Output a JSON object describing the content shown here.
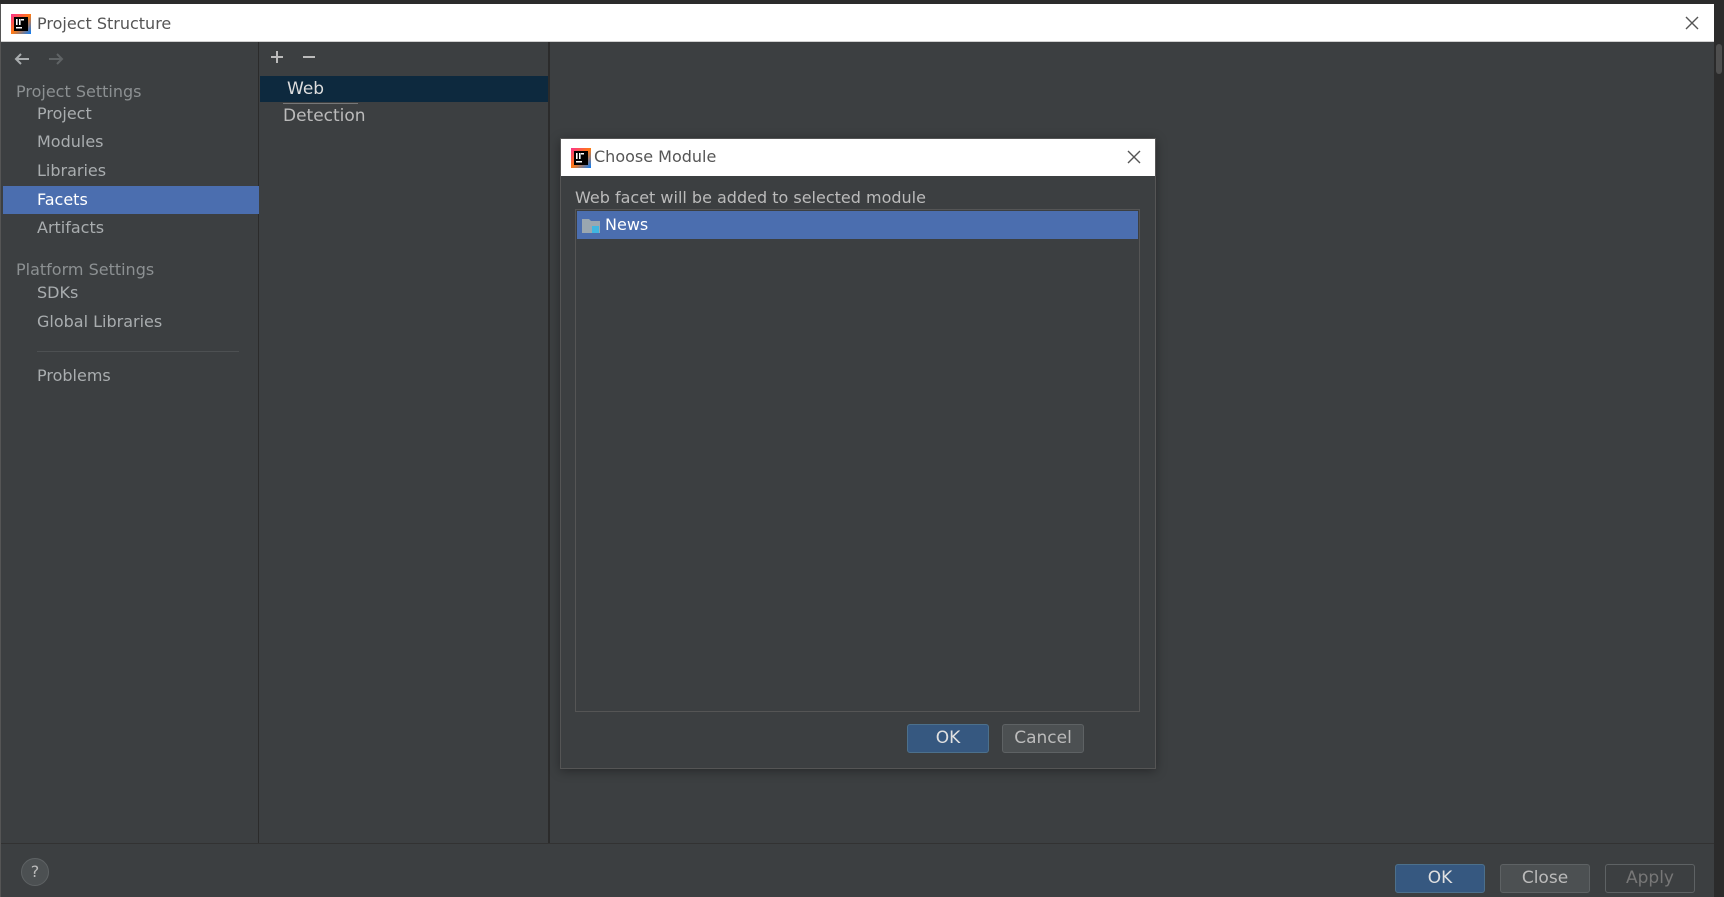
{
  "window": {
    "title": "Project Structure"
  },
  "sidebar": {
    "sections": {
      "project_settings": "Project Settings",
      "platform_settings": "Platform Settings"
    },
    "items": {
      "project": "Project",
      "modules": "Modules",
      "libraries": "Libraries",
      "facets": "Facets",
      "artifacts": "Artifacts",
      "sdks": "SDKs",
      "global_libraries": "Global Libraries",
      "problems": "Problems"
    },
    "selected": "Facets"
  },
  "facets_panel": {
    "items": [
      "Web",
      "Detection"
    ]
  },
  "dialog": {
    "title": "Choose Module",
    "label": "Web facet will be added to selected module",
    "modules": [
      "News"
    ],
    "ok_label": "OK",
    "cancel_label": "Cancel"
  },
  "footer": {
    "help_label": "?",
    "ok_label": "OK",
    "close_label": "Close",
    "apply_label": "Apply"
  },
  "icons": {
    "app": "intellij-icon",
    "back": "arrow-left-icon",
    "forward": "arrow-right-icon",
    "add": "plus-icon",
    "remove": "minus-icon",
    "module": "module-folder-icon",
    "close": "close-icon"
  },
  "colors": {
    "selection": "#4b6eaf",
    "primary_button": "#365880",
    "background": "#3c3f41"
  }
}
